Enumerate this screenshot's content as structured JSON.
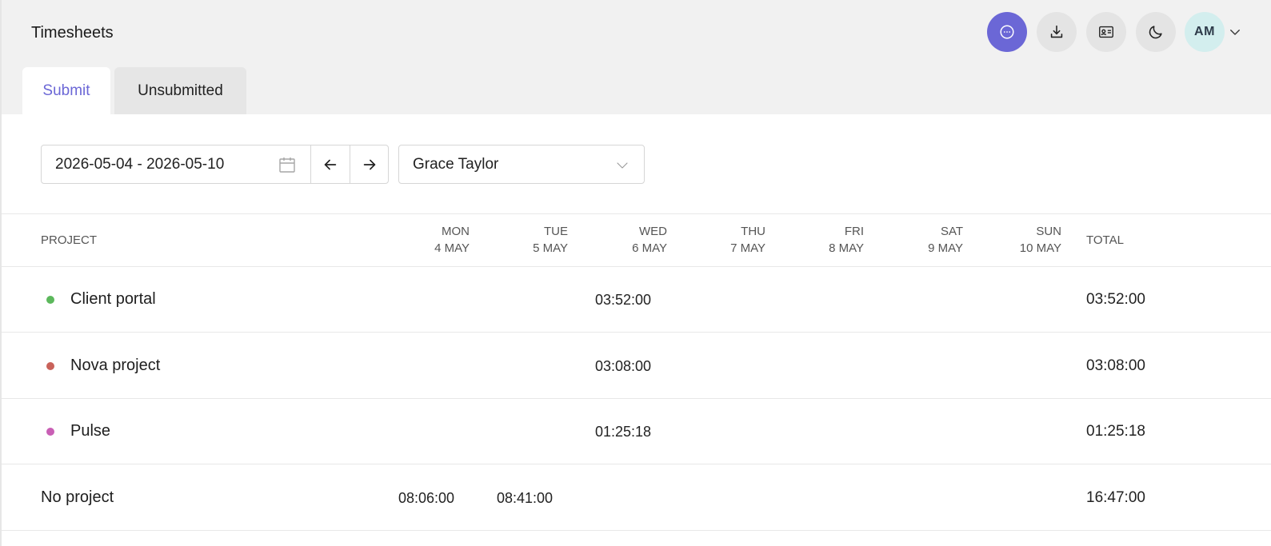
{
  "header": {
    "title": "Timesheets",
    "avatar_initials": "AM"
  },
  "tabs": [
    {
      "label": "Submit",
      "active": true
    },
    {
      "label": "Unsubmitted",
      "active": false
    }
  ],
  "filters": {
    "date_range": "2026-05-04 - 2026-05-10",
    "user": "Grace Taylor"
  },
  "table": {
    "project_header": "PROJECT",
    "total_header": "TOTAL",
    "days": [
      {
        "day": "MON",
        "date": "4 MAY"
      },
      {
        "day": "TUE",
        "date": "5 MAY"
      },
      {
        "day": "WED",
        "date": "6 MAY"
      },
      {
        "day": "THU",
        "date": "7 MAY"
      },
      {
        "day": "FRI",
        "date": "8 MAY"
      },
      {
        "day": "SAT",
        "date": "9 MAY"
      },
      {
        "day": "SUN",
        "date": "10 MAY"
      }
    ],
    "rows": [
      {
        "project": "Client portal",
        "color": "#5cb85c",
        "mon": "",
        "tue": "",
        "wed": "03:52:00",
        "total": "03:52:00"
      },
      {
        "project": "Nova project",
        "color": "#c9625a",
        "mon": "",
        "tue": "",
        "wed": "03:08:00",
        "total": "03:08:00"
      },
      {
        "project": "Pulse",
        "color": "#c95fb5",
        "mon": "",
        "tue": "",
        "wed": "01:25:18",
        "total": "01:25:18"
      },
      {
        "project": "No project",
        "color": "",
        "mon": "08:06:00",
        "tue": "08:41:00",
        "wed": "",
        "total": "16:47:00"
      }
    ]
  },
  "colors": {
    "accent": "#6b67d6",
    "topbar": "#f1f1f1"
  }
}
